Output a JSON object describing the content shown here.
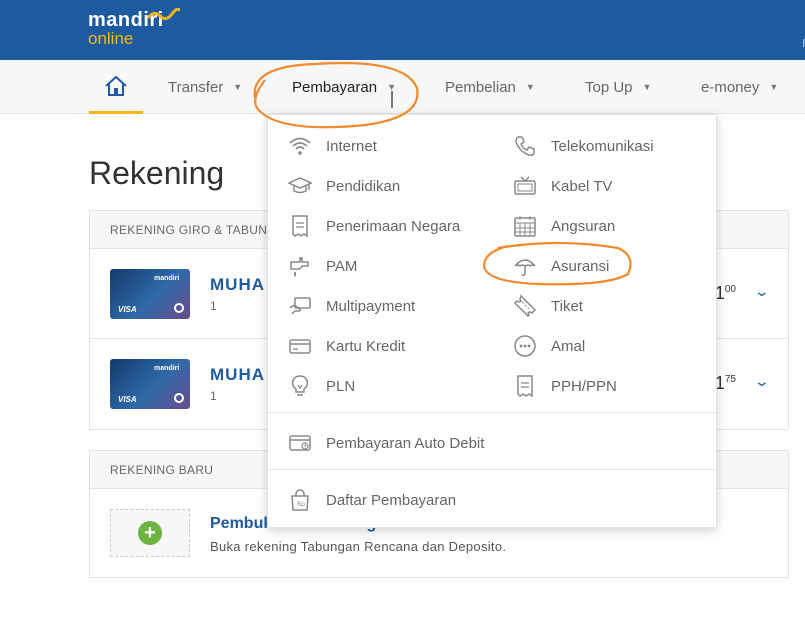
{
  "brand": {
    "line1": "mandiri",
    "line2": "online"
  },
  "nav": {
    "home_icon": "home-icon",
    "items": [
      {
        "label": "Transfer"
      },
      {
        "label": "Pembayaran"
      },
      {
        "label": "Pembelian"
      },
      {
        "label": "Top Up"
      },
      {
        "label": "e-money"
      }
    ],
    "active": "Pembayaran"
  },
  "page": {
    "title": "Rekening"
  },
  "accounts_panel": {
    "header": "REKENING GIRO & TABUNG",
    "accounts": [
      {
        "card_brand": "mandiri",
        "card_network": "VISA",
        "name": "MUHA",
        "number": "1",
        "balance_int": "1",
        "balance_dec": "00"
      },
      {
        "card_brand": "mandiri",
        "card_network": "VISA",
        "name": "MUHA",
        "number": "1",
        "balance_int": "1",
        "balance_dec": "75"
      }
    ]
  },
  "new_account_panel": {
    "header": "REKENING BARU",
    "title": "Pembukaan Rekening Baru",
    "subtitle": "Buka rekening Tabungan Rencana dan Deposito."
  },
  "dropdown": {
    "left_column": [
      {
        "label": "Internet",
        "icon": "wifi-icon"
      },
      {
        "label": "Pendidikan",
        "icon": "graduation-cap-icon"
      },
      {
        "label": "Penerimaan Negara",
        "icon": "receipt-icon"
      },
      {
        "label": "PAM",
        "icon": "water-tap-icon"
      },
      {
        "label": "Multipayment",
        "icon": "multipayment-icon"
      },
      {
        "label": "Kartu Kredit",
        "icon": "credit-card-icon"
      },
      {
        "label": "PLN",
        "icon": "lightbulb-icon"
      }
    ],
    "right_column": [
      {
        "label": "Telekomunikasi",
        "icon": "phone-icon"
      },
      {
        "label": "Kabel TV",
        "icon": "tv-icon"
      },
      {
        "label": "Angsuran",
        "icon": "calendar-icon"
      },
      {
        "label": "Asuransi",
        "icon": "umbrella-icon"
      },
      {
        "label": "Tiket",
        "icon": "ticket-icon"
      },
      {
        "label": "Amal",
        "icon": "charity-icon"
      },
      {
        "label": "PPH/PPN",
        "icon": "tax-receipt-icon"
      }
    ],
    "auto_debit": {
      "label": "Pembayaran Auto Debit",
      "icon": "auto-debit-card-icon"
    },
    "list": {
      "label": "Daftar Pembayaran",
      "icon": "shopping-bag-icon",
      "bag_label": "Rp"
    }
  },
  "colors": {
    "primary": "#1e5aa0",
    "accent": "#f5b617",
    "annotation": "#f08a2c",
    "plus": "#6cb33f"
  }
}
